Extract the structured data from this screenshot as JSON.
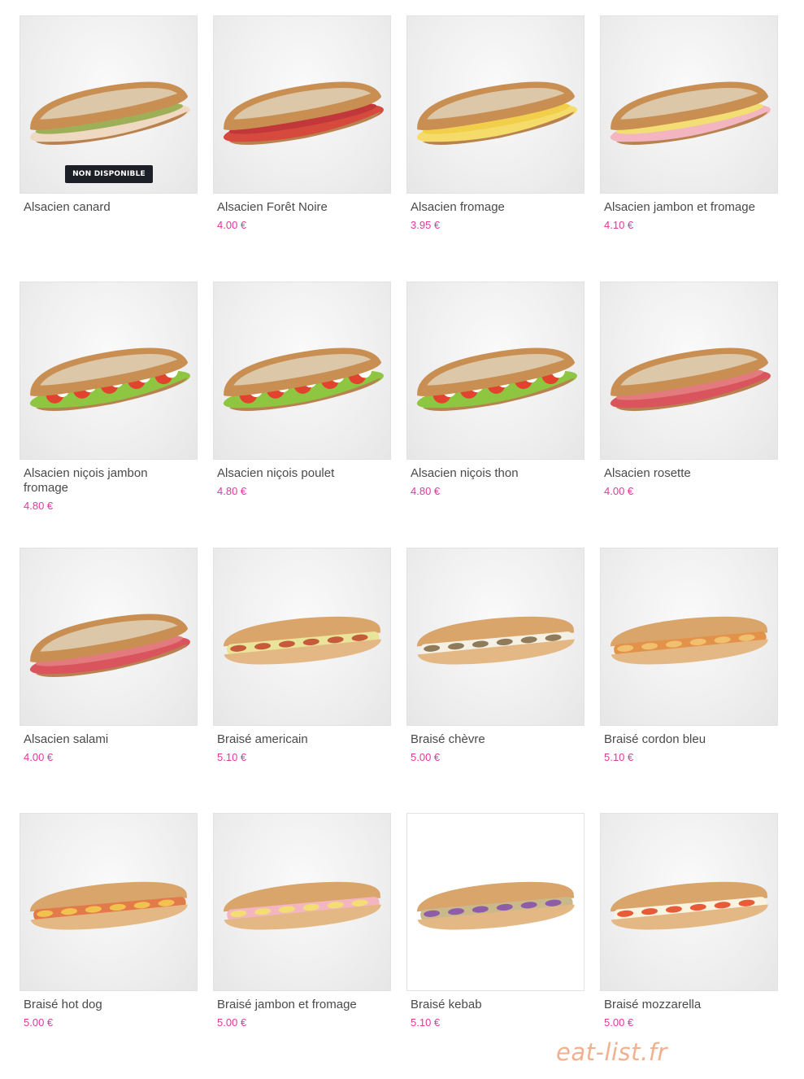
{
  "products": [
    {
      "name": "Alsacien canard",
      "price": "",
      "badge": "NON DISPONIBLE",
      "style": "alsacien",
      "filling": "duck",
      "icon": "sandwich-image"
    },
    {
      "name": "Alsacien Forêt Noire",
      "price": "4.00 €",
      "badge": "",
      "style": "alsacien",
      "filling": "ham-red",
      "icon": "sandwich-image"
    },
    {
      "name": "Alsacien fromage",
      "price": "3.95 €",
      "badge": "",
      "style": "alsacien",
      "filling": "cheese",
      "icon": "sandwich-image"
    },
    {
      "name": "Alsacien jambon et fromage",
      "price": "4.10 €",
      "badge": "",
      "style": "alsacien",
      "filling": "ham-cheese",
      "icon": "sandwich-image"
    },
    {
      "name": "Alsacien niçois jambon fromage",
      "price": "4.80 €",
      "badge": "",
      "style": "alsacien",
      "filling": "nicois",
      "icon": "sandwich-image"
    },
    {
      "name": "Alsacien niçois poulet",
      "price": "4.80 €",
      "badge": "",
      "style": "alsacien",
      "filling": "nicois",
      "icon": "sandwich-image"
    },
    {
      "name": "Alsacien niçois thon",
      "price": "4.80 €",
      "badge": "",
      "style": "alsacien",
      "filling": "nicois",
      "icon": "sandwich-image"
    },
    {
      "name": "Alsacien rosette",
      "price": "4.00 €",
      "badge": "",
      "style": "alsacien",
      "filling": "salami",
      "icon": "sandwich-image"
    },
    {
      "name": "Alsacien salami",
      "price": "4.00 €",
      "badge": "",
      "style": "alsacien",
      "filling": "salami",
      "icon": "sandwich-image"
    },
    {
      "name": "Braisé americain",
      "price": "5.10 €",
      "badge": "",
      "style": "braise",
      "filling": "american",
      "icon": "sandwich-image"
    },
    {
      "name": "Braisé chèvre",
      "price": "5.00 €",
      "badge": "",
      "style": "braise",
      "filling": "goat",
      "icon": "sandwich-image"
    },
    {
      "name": "Braisé cordon bleu",
      "price": "5.10 €",
      "badge": "",
      "style": "braise",
      "filling": "cordon",
      "icon": "sandwich-image"
    },
    {
      "name": "Braisé hot dog",
      "price": "5.00 €",
      "badge": "",
      "style": "braise",
      "filling": "hotdog",
      "icon": "sandwich-image"
    },
    {
      "name": "Braisé jambon et fromage",
      "price": "5.00 €",
      "badge": "",
      "style": "braise",
      "filling": "ham-cheese",
      "icon": "sandwich-image"
    },
    {
      "name": "Braisé kebab",
      "price": "5.10 €",
      "badge": "",
      "style": "braise",
      "filling": "kebab",
      "icon": "sandwich-image"
    },
    {
      "name": "Braisé mozzarella",
      "price": "5.00 €",
      "badge": "",
      "style": "braise",
      "filling": "mozzarella",
      "icon": "sandwich-image"
    }
  ],
  "watermark": "eat-list.fr",
  "colors": {
    "price": "#e0399e",
    "name": "#4a4a4a",
    "badge_bg": "#1c1f26",
    "watermark": "#f2b18e"
  }
}
